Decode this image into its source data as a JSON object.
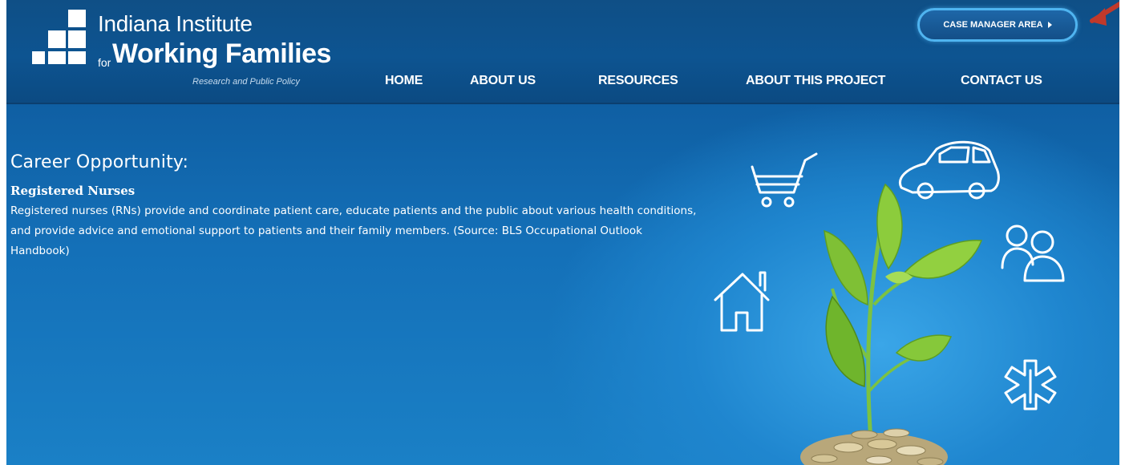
{
  "brand": {
    "name_line1": "Indiana Institute",
    "for_word": "for",
    "name_line2": "Working Families",
    "tagline": "Research and Public Policy"
  },
  "header": {
    "case_manager_button": "CASE MANAGER AREA",
    "nav": [
      {
        "label": "HOME"
      },
      {
        "label": "ABOUT US"
      },
      {
        "label": "RESOURCES"
      },
      {
        "label": "ABOUT THIS PROJECT"
      },
      {
        "label": "CONTACT US"
      }
    ]
  },
  "main": {
    "section_title": "Career Opportunity:",
    "occupation_title": "Registered Nurses",
    "occupation_description": "Registered nurses (RNs) provide and coordinate patient care, educate patients and the public about various health conditions, and provide advice and emotional support to patients and their family members. (Source: BLS Occupational Outlook Handbook)"
  },
  "illustration": {
    "icons": [
      "shopping-cart-icon",
      "car-icon",
      "people-icon",
      "house-icon",
      "medical-star-icon"
    ],
    "centerpiece": "plant-growing-from-coins"
  },
  "colors": {
    "header_bg": "#0d5491",
    "main_bg": "#1470b8",
    "button_border": "#4fb4f0",
    "annotation_arrow": "#c0392b"
  }
}
